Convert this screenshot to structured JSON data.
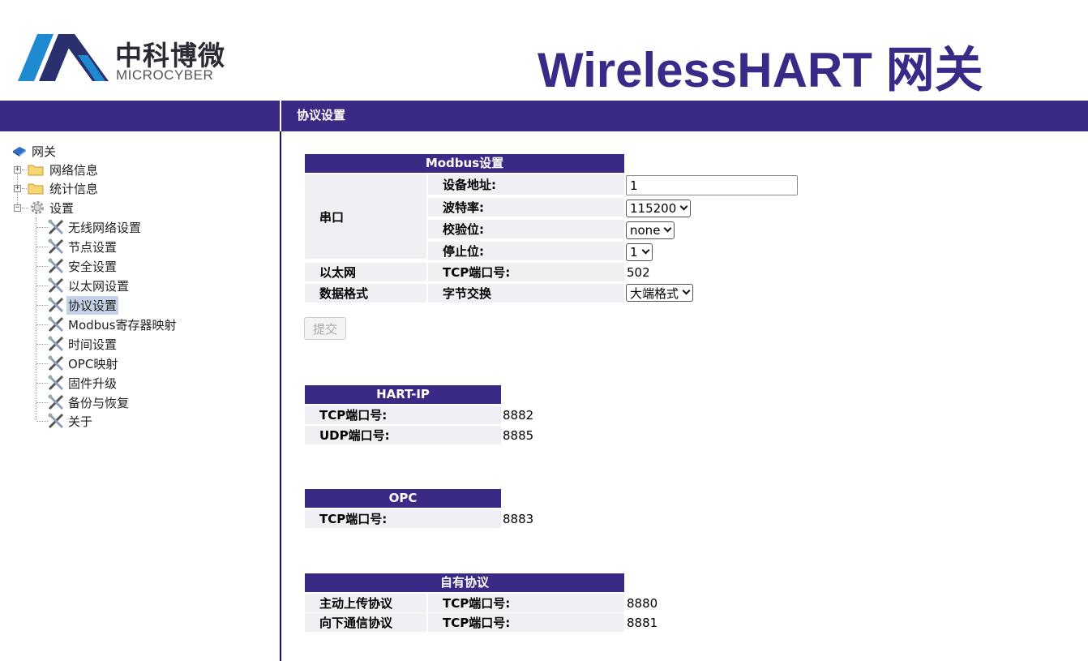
{
  "logo": {
    "cn": "中科博微",
    "en": "MICROCYBER"
  },
  "site_title": "WirelessHART 网关",
  "page_heading": "协议设置",
  "colors": {
    "brand": "#3b2a85",
    "cell_bg": "#eef0f3",
    "selected": "#c5d3ea"
  },
  "tree": {
    "root": {
      "label": "网关",
      "icon": "book-icon"
    },
    "network_info": {
      "label": "网络信息",
      "icon": "folder-icon"
    },
    "stats_info": {
      "label": "统计信息",
      "icon": "folder-icon"
    },
    "settings": {
      "label": "设置",
      "icon": "gear-icon"
    },
    "children": [
      {
        "label": "无线网络设置"
      },
      {
        "label": "节点设置"
      },
      {
        "label": "安全设置"
      },
      {
        "label": "以太网设置"
      },
      {
        "label": "协议设置",
        "selected": true
      },
      {
        "label": "Modbus寄存器映射"
      },
      {
        "label": "时间设置"
      },
      {
        "label": "OPC映射"
      },
      {
        "label": "固件升级"
      },
      {
        "label": "备份与恢复"
      },
      {
        "label": "关于"
      }
    ]
  },
  "modbus": {
    "title": "Modbus设置",
    "serial_label": "串口",
    "device_addr_label": "设备地址:",
    "device_addr_value": "1",
    "baud_label": "波特率:",
    "baud_value": "115200",
    "parity_label": "校验位:",
    "parity_value": "none",
    "stopbit_label": "停止位:",
    "stopbit_value": "1",
    "ethernet_label": "以太网",
    "tcp_port_label": "TCP端口号:",
    "tcp_port_value": "502",
    "data_format_label": "数据格式",
    "byte_swap_label": "字节交换",
    "byte_swap_value": "大端格式",
    "submit_label": "提交"
  },
  "hartip": {
    "title": "HART-IP",
    "tcp_label": "TCP端口号:",
    "tcp_value": "8882",
    "udp_label": "UDP端口号:",
    "udp_value": "8885"
  },
  "opc": {
    "title": "OPC",
    "tcp_label": "TCP端口号:",
    "tcp_value": "8883"
  },
  "own": {
    "title": "自有协议",
    "upload_label": "主动上传协议",
    "upload_port_label": "TCP端口号:",
    "upload_port_value": "8880",
    "down_label": "向下通信协议",
    "down_port_label": "TCP端口号:",
    "down_port_value": "8881"
  }
}
